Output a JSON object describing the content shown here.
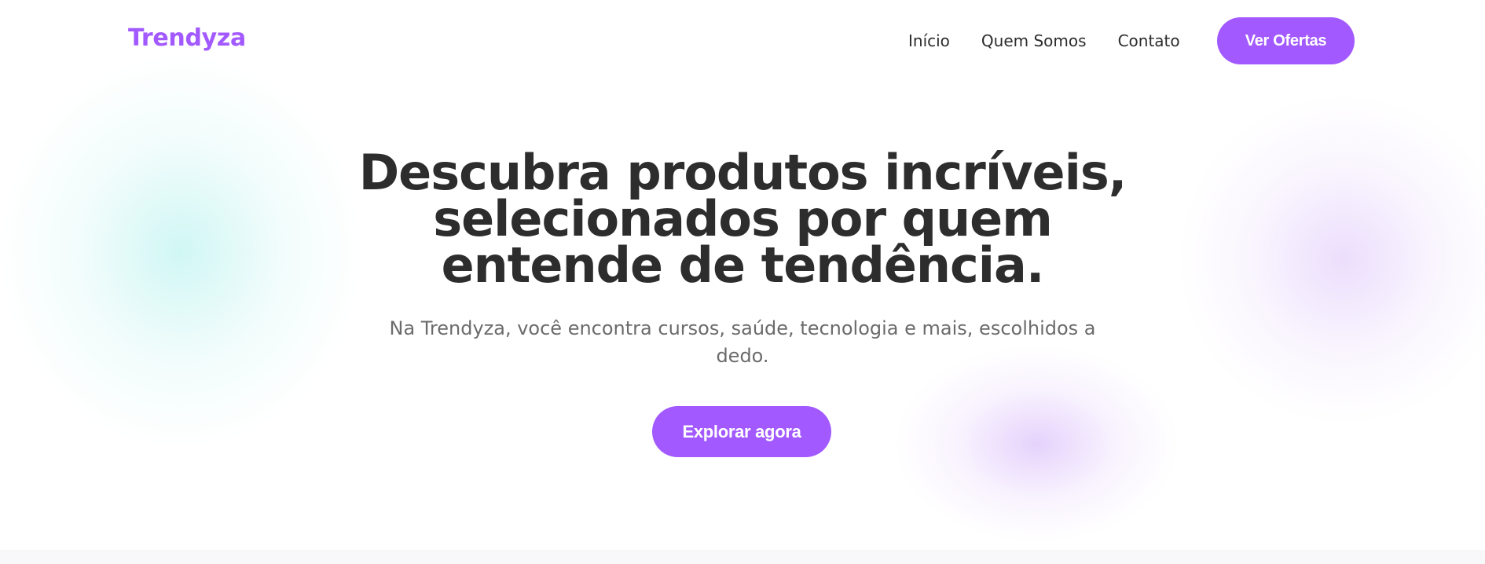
{
  "colors": {
    "brand": "#a259ff",
    "heading": "#2d2d2d",
    "body_text": "#6b6b6b",
    "nav_text": "#2c2c2c",
    "button_text": "#ffffff"
  },
  "header": {
    "brand": "Trendyza",
    "nav": [
      {
        "label": "Início"
      },
      {
        "label": "Quem Somos"
      },
      {
        "label": "Contato"
      }
    ],
    "cta_label": "Ver Ofertas"
  },
  "hero": {
    "title": "Descubra produtos incríveis, selecionados por quem entende de tendência.",
    "subtitle": "Na Trendyza, você encontra cursos, saúde, tecnologia e mais, escolhidos a dedo.",
    "cta_label": "Explorar agora"
  }
}
